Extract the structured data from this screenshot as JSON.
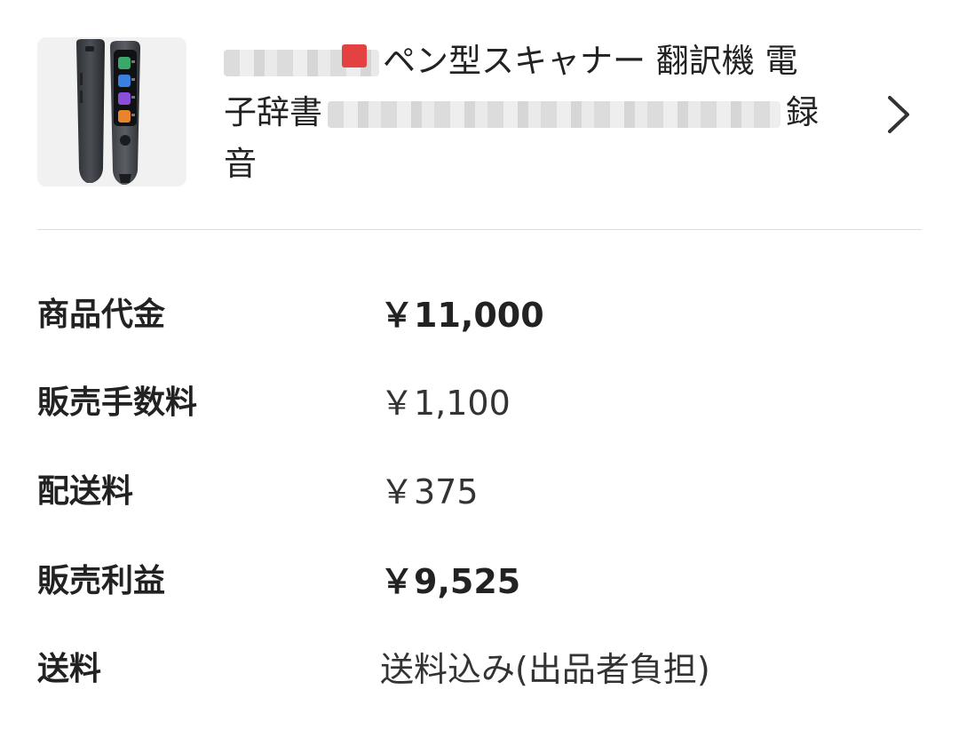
{
  "product": {
    "title_line1": "ペン型スキャナー 翻訳機 電",
    "title_line2_start": "子辞書",
    "title_line2_end": "録",
    "title_line3": "音"
  },
  "summary": {
    "rows": [
      {
        "label": "商品代金",
        "value": "￥11,000",
        "emphasis": true
      },
      {
        "label": "販売手数料",
        "value": "￥1,100",
        "emphasis": false
      },
      {
        "label": "配送料",
        "value": "￥375",
        "emphasis": false
      },
      {
        "label": "販売利益",
        "value": "￥9,525",
        "emphasis": true
      },
      {
        "label": "送料",
        "value": "送料込み(出品者負担)",
        "emphasis": false
      }
    ]
  },
  "icons": {
    "chevron": "chevron-right-icon"
  },
  "colors": {
    "text": "#222222",
    "divider": "#dddddd",
    "thumb_bg": "#f1f1f1"
  }
}
